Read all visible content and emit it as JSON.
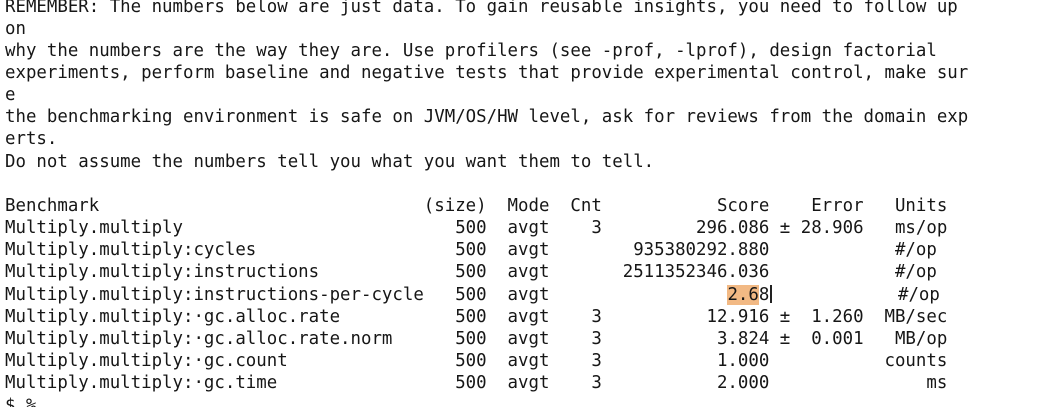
{
  "notice": {
    "line1": "REMEMBER: The numbers below are just data. To gain reusable insights, you need to follow up",
    "line2": "on",
    "line3": "why the numbers are the way they are. Use profilers (see -prof, -lprof), design factorial",
    "line4": "experiments, perform baseline and negative tests that provide experimental control, make sur",
    "line5": "e",
    "line6": "the benchmarking environment is safe on JVM/OS/HW level, ask for reviews from the domain exp",
    "line7": "erts.",
    "line8": "Do not assume the numbers tell you what you want them to tell."
  },
  "table": {
    "header": "Benchmark                               (size)  Mode  Cnt           Score    Error   Units",
    "rows": [
      "Multiply.multiply                          500  avgt    3         296.086 ± 28.906   ms/op",
      "Multiply.multiply:cycles                   500  avgt        935380292.880            #/op",
      "Multiply.multiply:instructions             500  avgt       2511352346.036            #/op",
      "Multiply.multiply:·gc.alloc.rate           500  avgt    3          12.916 ±  1.260  MB/sec",
      "Multiply.multiply:·gc.alloc.rate.norm      500  avgt    3           3.824 ±  0.001   MB/op",
      "Multiply.multiply:·gc.count                500  avgt    3           1.000           counts",
      "Multiply.multiply:·gc.time                 500  avgt    3           2.000               ms"
    ],
    "ipc_row": {
      "before": "Multiply.multiply:instructions-per-cycle   500  avgt                 ",
      "selected": "2.6",
      "rest": "8",
      "after": "            #/op"
    }
  },
  "prompt": "$ %"
}
